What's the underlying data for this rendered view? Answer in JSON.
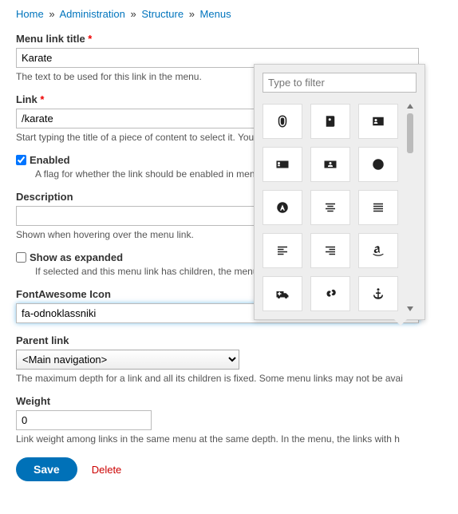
{
  "breadcrumb": {
    "home": "Home",
    "admin": "Administration",
    "structure": "Structure",
    "menus": "Menus",
    "sep": "»"
  },
  "fields": {
    "title": {
      "label": "Menu link title",
      "value": "Karate",
      "desc": "The text to be used for this link in the menu."
    },
    "link": {
      "label": "Link",
      "value": "/karate",
      "desc": "Start typing the title of a piece of content to select it. You can also enter an internal path su"
    },
    "enabled": {
      "label": "Enabled",
      "desc": "A flag for whether the link should be enabled in menus or hidden."
    },
    "description": {
      "label": "Description",
      "value": "",
      "desc": "Shown when hovering over the menu link."
    },
    "expanded": {
      "label": "Show as expanded",
      "desc": "If selected and this menu link has children, the menu will always appear expanded."
    },
    "fa": {
      "label": "FontAwesome Icon",
      "value": "fa-odnoklassniki"
    },
    "parent": {
      "label": "Parent link",
      "value": "<Main navigation>",
      "desc": "The maximum depth for a link and all its children is fixed. Some menu links may not be avai"
    },
    "weight": {
      "label": "Weight",
      "value": "0",
      "desc": "Link weight among links in the same menu at the same depth. In the menu, the links with h"
    }
  },
  "picker": {
    "placeholder": "Type to filter"
  },
  "actions": {
    "save": "Save",
    "delete": "Delete"
  }
}
